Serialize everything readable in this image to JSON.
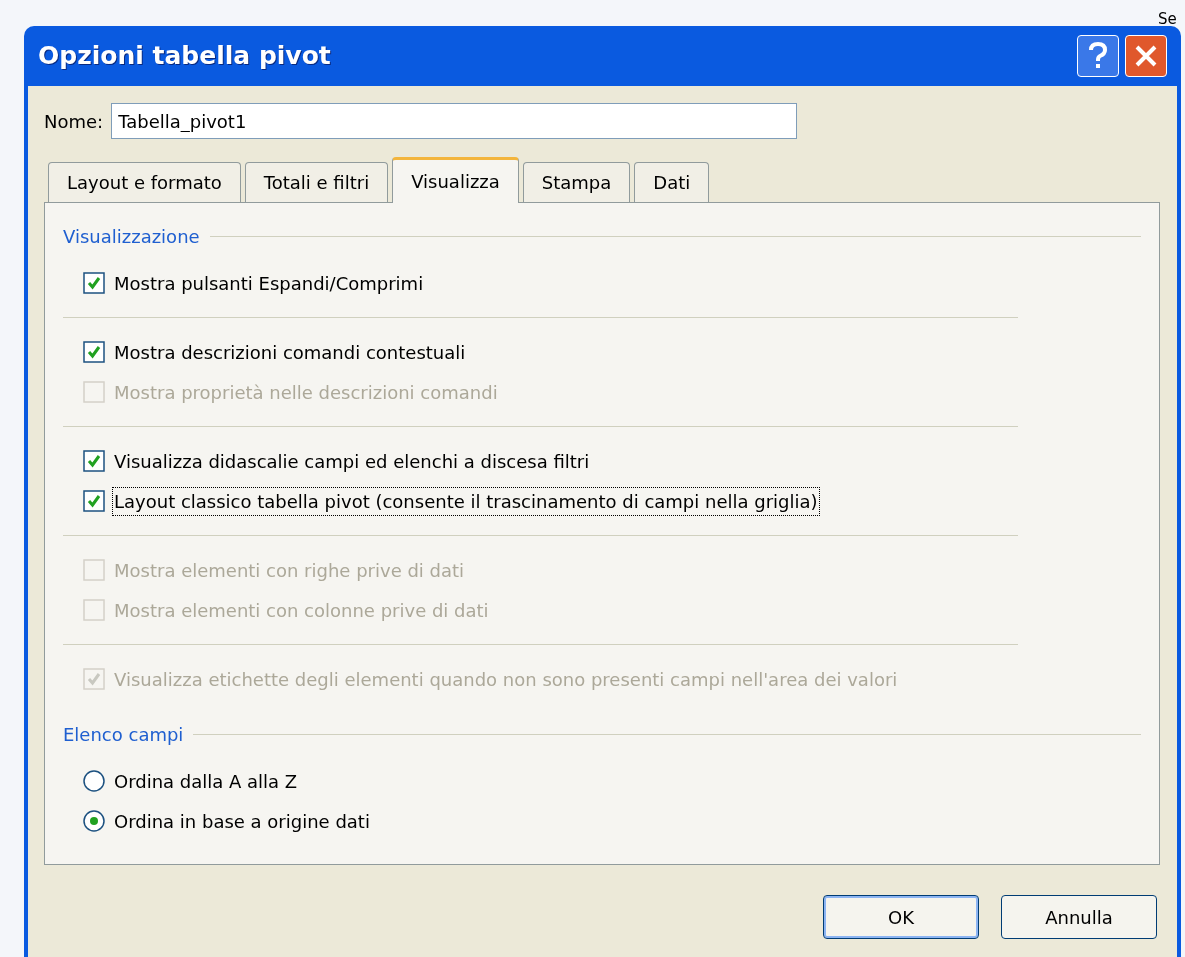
{
  "background": {
    "corner_text": "Se"
  },
  "window": {
    "title": "Opzioni tabella pivot"
  },
  "name_field": {
    "label": "Nome:",
    "value": "Tabella_pivot1"
  },
  "tabs": [
    {
      "label": "Layout e formato",
      "selected": false
    },
    {
      "label": "Totali e filtri",
      "selected": false
    },
    {
      "label": "Visualizza",
      "selected": true
    },
    {
      "label": "Stampa",
      "selected": false
    },
    {
      "label": "Dati",
      "selected": false
    }
  ],
  "sections": [
    {
      "title": "Visualizzazione",
      "groups": [
        [
          {
            "kind": "checkbox",
            "label": "Mostra pulsanti Espandi/Comprimi",
            "checked": true,
            "disabled": false,
            "focused": false
          }
        ],
        [
          {
            "kind": "checkbox",
            "label": "Mostra descrizioni comandi contestuali",
            "checked": true,
            "disabled": false,
            "focused": false
          },
          {
            "kind": "checkbox",
            "label": "Mostra proprietà nelle descrizioni comandi",
            "checked": false,
            "disabled": true,
            "focused": false
          }
        ],
        [
          {
            "kind": "checkbox",
            "label": "Visualizza didascalie campi ed elenchi a discesa filtri",
            "checked": true,
            "disabled": false,
            "focused": false
          },
          {
            "kind": "checkbox",
            "label": "Layout classico tabella pivot (consente il trascinamento di campi nella griglia)",
            "checked": true,
            "disabled": false,
            "focused": true
          }
        ],
        [
          {
            "kind": "checkbox",
            "label": "Mostra elementi con righe prive di dati",
            "checked": false,
            "disabled": true,
            "focused": false
          },
          {
            "kind": "checkbox",
            "label": "Mostra elementi con colonne prive di dati",
            "checked": false,
            "disabled": true,
            "focused": false
          }
        ],
        [
          {
            "kind": "checkbox",
            "label": "Visualizza etichette degli elementi quando non sono presenti campi nell'area dei valori",
            "checked": true,
            "disabled": true,
            "focused": false
          }
        ]
      ]
    },
    {
      "title": "Elenco campi",
      "groups": [
        [
          {
            "kind": "radio",
            "label": "Ordina dalla A alla Z",
            "selected": false,
            "disabled": false,
            "focused": false
          },
          {
            "kind": "radio",
            "label": "Ordina in base a origine dati",
            "selected": true,
            "disabled": false,
            "focused": false
          }
        ]
      ]
    }
  ],
  "buttons": [
    {
      "label": "OK",
      "default": true
    },
    {
      "label": "Annulla",
      "default": false
    }
  ]
}
